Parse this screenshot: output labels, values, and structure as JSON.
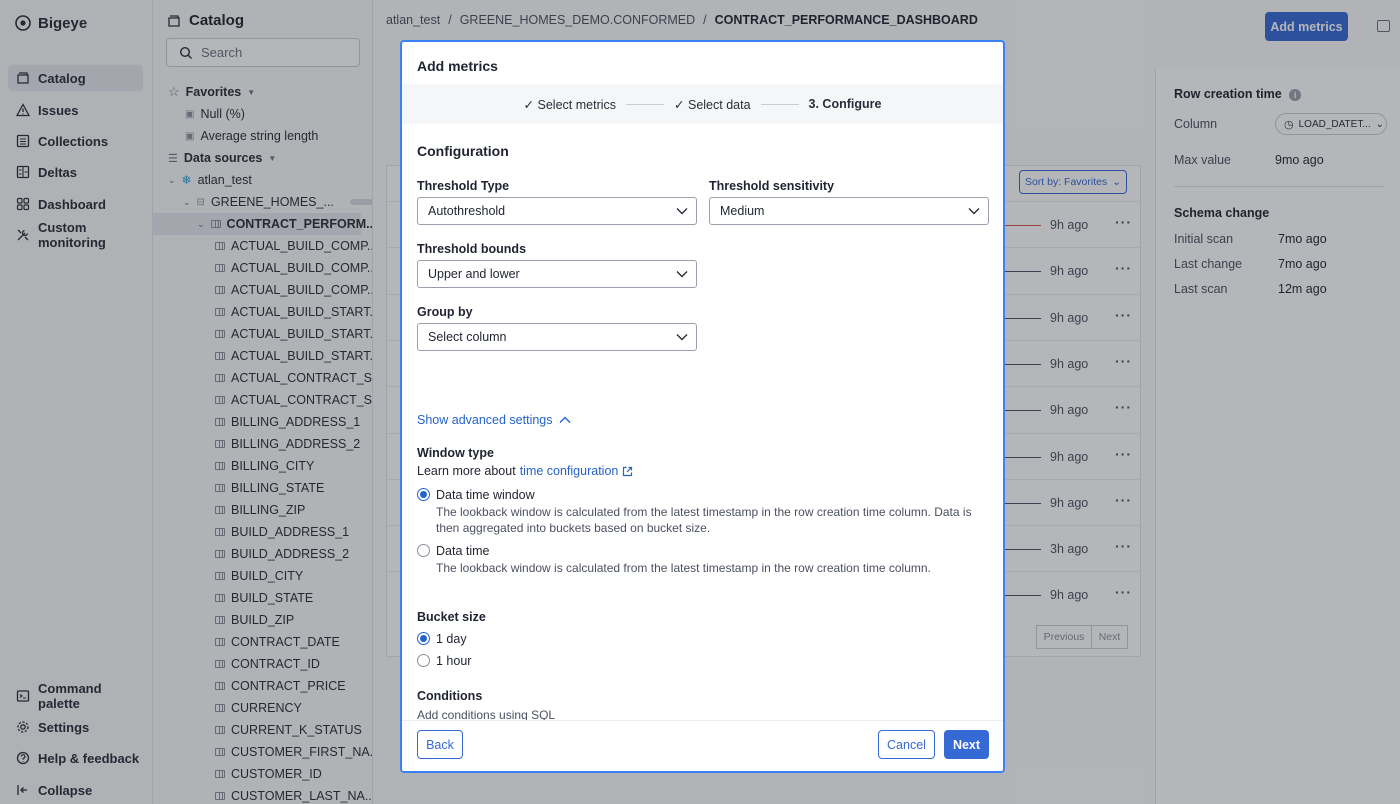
{
  "app": {
    "brand": "Bigeye"
  },
  "nav": {
    "items": [
      {
        "label": "Catalog"
      },
      {
        "label": "Issues"
      },
      {
        "label": "Collections"
      },
      {
        "label": "Deltas"
      },
      {
        "label": "Dashboard"
      },
      {
        "label": "Custom monitoring"
      }
    ],
    "bottom": [
      {
        "label": "Command palette"
      },
      {
        "label": "Settings"
      },
      {
        "label": "Help & feedback"
      },
      {
        "label": "Collapse"
      }
    ]
  },
  "catalog": {
    "title": "Catalog",
    "search_placeholder": "Search",
    "favorites_label": "Favorites",
    "favorites": [
      "Null (%)",
      "Average string length"
    ],
    "data_sources_label": "Data sources",
    "source": "atlan_test",
    "schema": "GREENE_HOMES_...",
    "table": "CONTRACT_PERFORM...",
    "columns": [
      "ACTUAL_BUILD_COMP...",
      "ACTUAL_BUILD_COMP...",
      "ACTUAL_BUILD_COMP...",
      "ACTUAL_BUILD_START...",
      "ACTUAL_BUILD_START...",
      "ACTUAL_BUILD_START...",
      "ACTUAL_CONTRACT_S...",
      "ACTUAL_CONTRACT_S...",
      "BILLING_ADDRESS_1",
      "BILLING_ADDRESS_2",
      "BILLING_CITY",
      "BILLING_STATE",
      "BILLING_ZIP",
      "BUILD_ADDRESS_1",
      "BUILD_ADDRESS_2",
      "BUILD_CITY",
      "BUILD_STATE",
      "BUILD_ZIP",
      "CONTRACT_DATE",
      "CONTRACT_ID",
      "CONTRACT_PRICE",
      "CURRENCY",
      "CURRENT_K_STATUS",
      "CUSTOMER_FIRST_NA...",
      "CUSTOMER_ID",
      "CUSTOMER_LAST_NA..."
    ]
  },
  "main": {
    "breadcrumb": [
      "atlan_test",
      "GREENE_HOMES_DEMO.CONFORMED",
      "CONTRACT_PERFORMANCE_DASHBOARD"
    ],
    "add_metrics_label": "Add metrics",
    "sort_label": "Sort by: Favorites",
    "row_times": [
      "9h ago",
      "9h ago",
      "9h ago",
      "9h ago",
      "9h ago",
      "9h ago",
      "9h ago",
      "3h ago",
      "9h ago"
    ],
    "previous_label": "Previous",
    "next_label": "Next"
  },
  "right_pane": {
    "row_creation_title": "Row creation time",
    "column_key": "Column",
    "column_value": "LOAD_DATET...",
    "max_value_key": "Max value",
    "max_value": "9mo ago",
    "schema_change_title": "Schema change",
    "initial_scan_key": "Initial scan",
    "initial_scan": "7mo ago",
    "last_change_key": "Last change",
    "last_change": "7mo ago",
    "last_scan_key": "Last scan",
    "last_scan": "12m ago"
  },
  "modal": {
    "title": "Add metrics",
    "steps": [
      "Select metrics",
      "Select data",
      "3. Configure"
    ],
    "section_title": "Configuration",
    "threshold_type_label": "Threshold Type",
    "threshold_type_value": "Autothreshold",
    "threshold_sensitivity_label": "Threshold sensitivity",
    "threshold_sensitivity_value": "Medium",
    "threshold_bounds_label": "Threshold bounds",
    "threshold_bounds_value": "Upper and lower",
    "group_by_label": "Group by",
    "group_by_value": "Select column",
    "advanced_toggle": "Show advanced settings",
    "window_type_label": "Window type",
    "learn_more_prefix": "Learn more about",
    "learn_more_link": "time configuration",
    "window_options": [
      {
        "label": "Data time window",
        "description": "The lookback window is calculated from the latest timestamp in the row creation time column. Data is then aggregated into buckets based on bucket size.",
        "selected": true
      },
      {
        "label": "Data time",
        "description": "The lookback window is calculated from the latest timestamp in the row creation time column.",
        "selected": false
      }
    ],
    "bucket_size_label": "Bucket size",
    "bucket_options": [
      {
        "label": "1 day",
        "selected": true
      },
      {
        "label": "1 hour",
        "selected": false
      }
    ],
    "conditions_label": "Conditions",
    "conditions_help": "Add conditions using SQL",
    "back_label": "Back",
    "cancel_label": "Cancel",
    "next_label": "Next"
  }
}
